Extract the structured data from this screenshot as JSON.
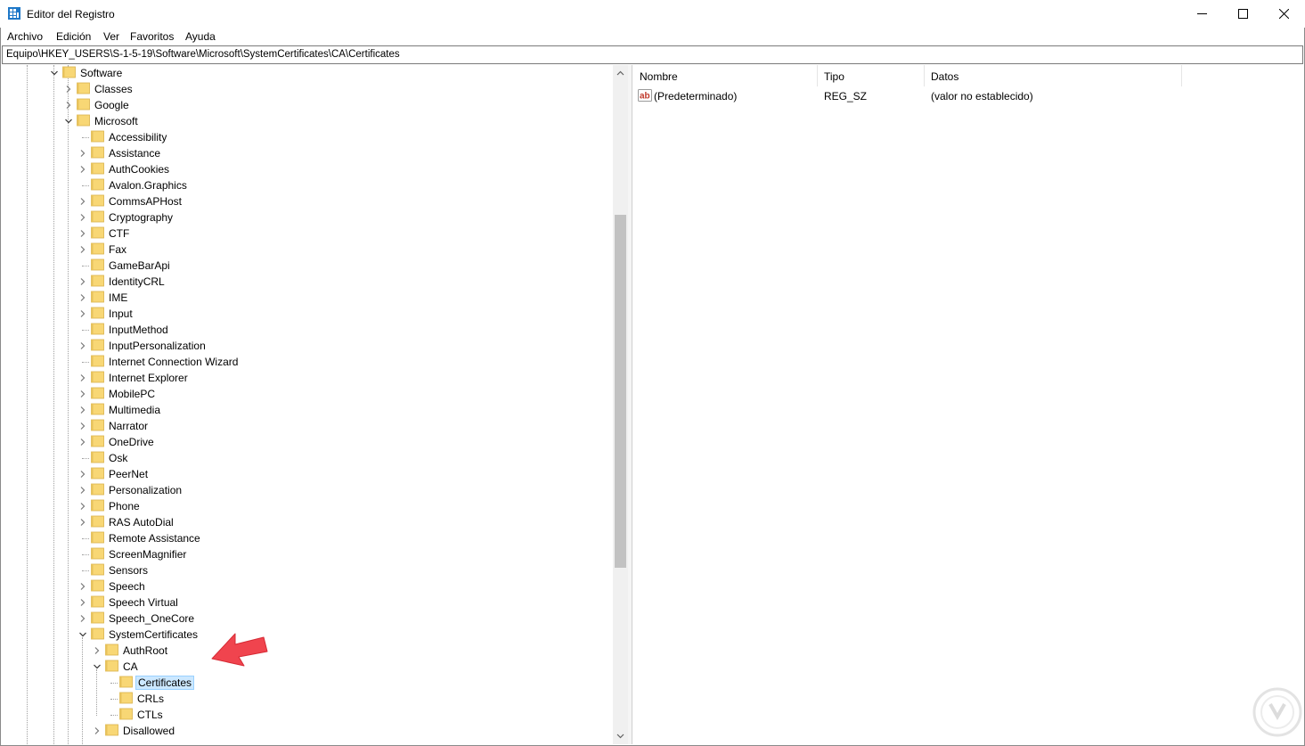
{
  "window": {
    "title": "Editor del Registro",
    "controls": [
      "minimize",
      "maximize",
      "close"
    ]
  },
  "menu": [
    "Archivo",
    "Edición",
    "Ver",
    "Favoritos",
    "Ayuda"
  ],
  "address": "Equipo\\HKEY_USERS\\S-1-5-19\\Software\\Microsoft\\SystemCertificates\\CA\\Certificates",
  "tree": [
    {
      "label": "Software",
      "expander": "expanded"
    },
    {
      "label": "Classes",
      "expander": "collapsed"
    },
    {
      "label": "Google",
      "expander": "collapsed"
    },
    {
      "label": "Microsoft",
      "expander": "expanded"
    },
    {
      "label": "Accessibility",
      "expander": "none"
    },
    {
      "label": "Assistance",
      "expander": "collapsed"
    },
    {
      "label": "AuthCookies",
      "expander": "collapsed"
    },
    {
      "label": "Avalon.Graphics",
      "expander": "none"
    },
    {
      "label": "CommsAPHost",
      "expander": "collapsed"
    },
    {
      "label": "Cryptography",
      "expander": "collapsed"
    },
    {
      "label": "CTF",
      "expander": "collapsed"
    },
    {
      "label": "Fax",
      "expander": "collapsed"
    },
    {
      "label": "GameBarApi",
      "expander": "none"
    },
    {
      "label": "IdentityCRL",
      "expander": "collapsed"
    },
    {
      "label": "IME",
      "expander": "collapsed"
    },
    {
      "label": "Input",
      "expander": "collapsed"
    },
    {
      "label": "InputMethod",
      "expander": "none"
    },
    {
      "label": "InputPersonalization",
      "expander": "collapsed"
    },
    {
      "label": "Internet Connection Wizard",
      "expander": "none"
    },
    {
      "label": "Internet Explorer",
      "expander": "collapsed"
    },
    {
      "label": "MobilePC",
      "expander": "collapsed"
    },
    {
      "label": "Multimedia",
      "expander": "collapsed"
    },
    {
      "label": "Narrator",
      "expander": "collapsed"
    },
    {
      "label": "OneDrive",
      "expander": "collapsed"
    },
    {
      "label": "Osk",
      "expander": "none"
    },
    {
      "label": "PeerNet",
      "expander": "collapsed"
    },
    {
      "label": "Personalization",
      "expander": "collapsed"
    },
    {
      "label": "Phone",
      "expander": "collapsed"
    },
    {
      "label": "RAS AutoDial",
      "expander": "collapsed"
    },
    {
      "label": "Remote Assistance",
      "expander": "none"
    },
    {
      "label": "ScreenMagnifier",
      "expander": "none"
    },
    {
      "label": "Sensors",
      "expander": "none"
    },
    {
      "label": "Speech",
      "expander": "collapsed"
    },
    {
      "label": "Speech Virtual",
      "expander": "collapsed"
    },
    {
      "label": "Speech_OneCore",
      "expander": "collapsed"
    },
    {
      "label": "SystemCertificates",
      "expander": "expanded"
    },
    {
      "label": "AuthRoot",
      "expander": "collapsed"
    },
    {
      "label": "CA",
      "expander": "expanded"
    },
    {
      "label": "Certificates",
      "expander": "none",
      "selected": true
    },
    {
      "label": "CRLs",
      "expander": "none"
    },
    {
      "label": "CTLs",
      "expander": "none"
    },
    {
      "label": "Disallowed",
      "expander": "collapsed"
    }
  ],
  "columns": [
    "Nombre",
    "Tipo",
    "Datos"
  ],
  "values": [
    {
      "name": "(Predeterminado)",
      "type": "REG_SZ",
      "data": "(valor no establecido)",
      "icon": "string-value-icon"
    }
  ],
  "colors": {
    "selection": "#cce8ff",
    "selection_border": "#99d1ff",
    "folder": "#f8d775",
    "annotation_arrow": "#f0444e"
  }
}
